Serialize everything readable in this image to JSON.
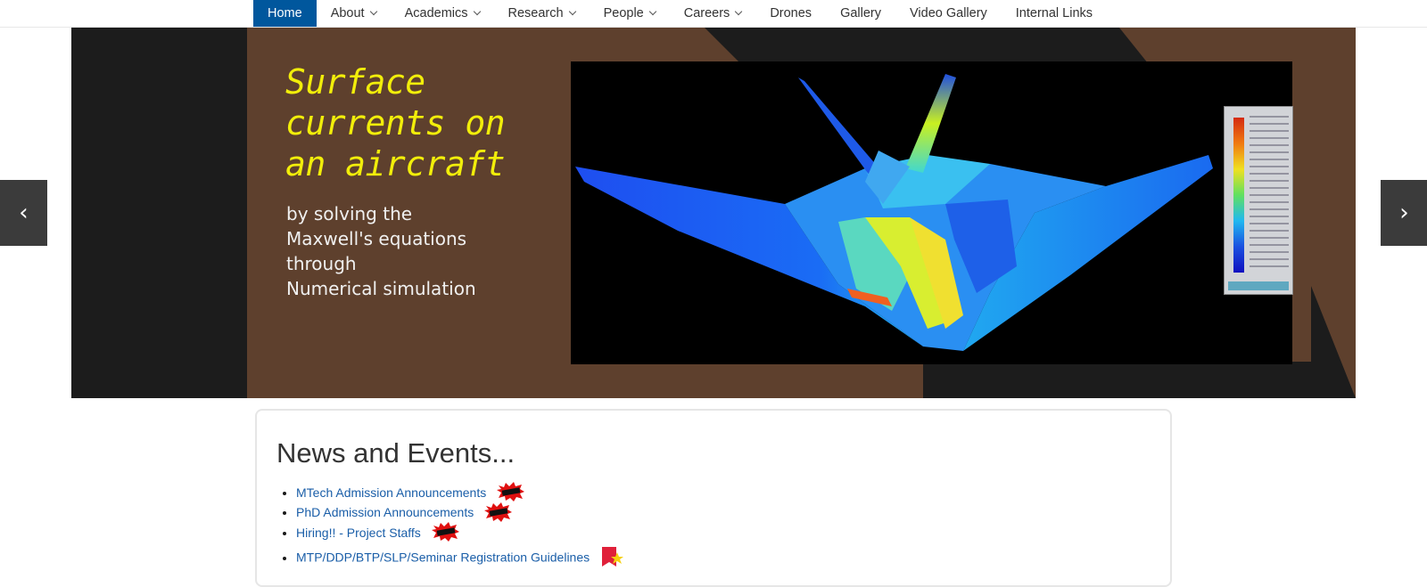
{
  "nav": {
    "items": [
      {
        "label": "Home",
        "dropdown": false,
        "active": true
      },
      {
        "label": "About",
        "dropdown": true
      },
      {
        "label": "Academics",
        "dropdown": true
      },
      {
        "label": "Research",
        "dropdown": true
      },
      {
        "label": "People",
        "dropdown": true
      },
      {
        "label": "Careers",
        "dropdown": true
      },
      {
        "label": "Drones",
        "dropdown": false
      },
      {
        "label": "Gallery",
        "dropdown": false
      },
      {
        "label": "Video Gallery",
        "dropdown": false
      },
      {
        "label": "Internal Links",
        "dropdown": false
      }
    ]
  },
  "carousel": {
    "headline_lines": [
      "Surface",
      "currents on",
      "an aircraft"
    ],
    "subline_lines": [
      "by solving the",
      "Maxwell's equations",
      "through",
      "Numerical simulation"
    ],
    "prev_icon": "chevron-left-icon",
    "next_icon": "chevron-right-icon",
    "colors": {
      "panel_brown": "#5e402d",
      "dark_band": "#1c1c1c",
      "headline": "#f2ee0a"
    }
  },
  "news": {
    "title": "News and Events...",
    "items": [
      {
        "label": "MTech Admission Announcements",
        "badge": "new-burst-icon"
      },
      {
        "label": "PhD Admission Announcements",
        "badge": "new-burst-icon"
      },
      {
        "label": "Hiring!! - Project Staffs",
        "badge": "new-burst-icon"
      },
      {
        "label": "MTP/DDP/BTP/SLP/Seminar Registration Guidelines",
        "badge": "star-flag-icon"
      }
    ]
  },
  "colors": {
    "nav_active": "#00579d",
    "link": "#1a5ea8"
  }
}
